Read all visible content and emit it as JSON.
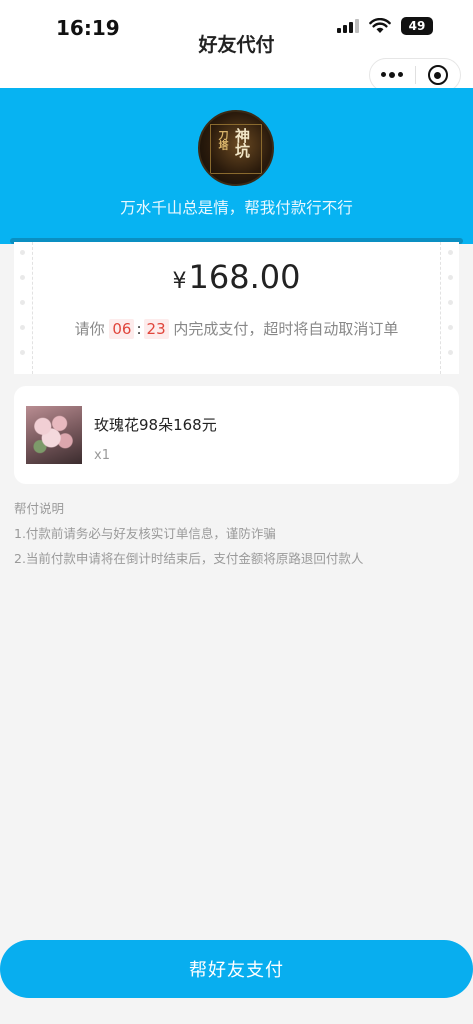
{
  "status_bar": {
    "time": "16:19",
    "battery": "49"
  },
  "nav": {
    "title": "好友代付"
  },
  "hero": {
    "avatar_text_1": "刀塔",
    "avatar_text_2": "神坑",
    "message": "万水千山总是情，帮我付款行不行"
  },
  "payment": {
    "currency": "¥",
    "amount": "168.00",
    "countdown_prefix": "请你",
    "minutes": "06",
    "separator": ":",
    "seconds": "23",
    "countdown_suffix": "内完成支付，超时将自动取消订单"
  },
  "product": {
    "name": "玫瑰花98朵168元",
    "quantity": "x1"
  },
  "instructions": {
    "title": "帮付说明",
    "items": [
      "1.付款前请务必与好友核实订单信息，谨防诈骗",
      "2.当前付款申请将在倒计时结束后，支付金额将原路退回付款人"
    ]
  },
  "actions": {
    "pay_label": "帮好友支付"
  },
  "colors": {
    "accent": "#07b3f2",
    "countdown": "#e0453b"
  }
}
